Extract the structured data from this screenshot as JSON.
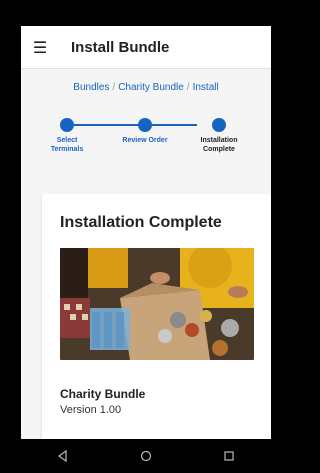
{
  "header": {
    "title": "Install Bundle",
    "menu_icon": "hamburger-menu-icon"
  },
  "breadcrumb": {
    "items": [
      "Bundles",
      "Charity Bundle",
      "Install"
    ],
    "separator": "/"
  },
  "stepper": {
    "steps": [
      {
        "label_line1": "Select",
        "label_line2": "Terminals",
        "state": "done"
      },
      {
        "label_line1": "Review Order",
        "label_line2": "",
        "state": "done"
      },
      {
        "label_line1": "Installation",
        "label_line2": "Complete",
        "state": "current"
      }
    ]
  },
  "card": {
    "title": "Installation Complete",
    "bundle_name": "Charity Bundle",
    "version": "Version 1.00",
    "image_icon": "charity-food-donation-photo"
  },
  "navbar": {
    "icons": [
      "back-icon",
      "home-icon",
      "recents-icon"
    ]
  },
  "colors": {
    "accent": "#1565c0",
    "background": "#f5f5f5",
    "text": "#222222"
  }
}
